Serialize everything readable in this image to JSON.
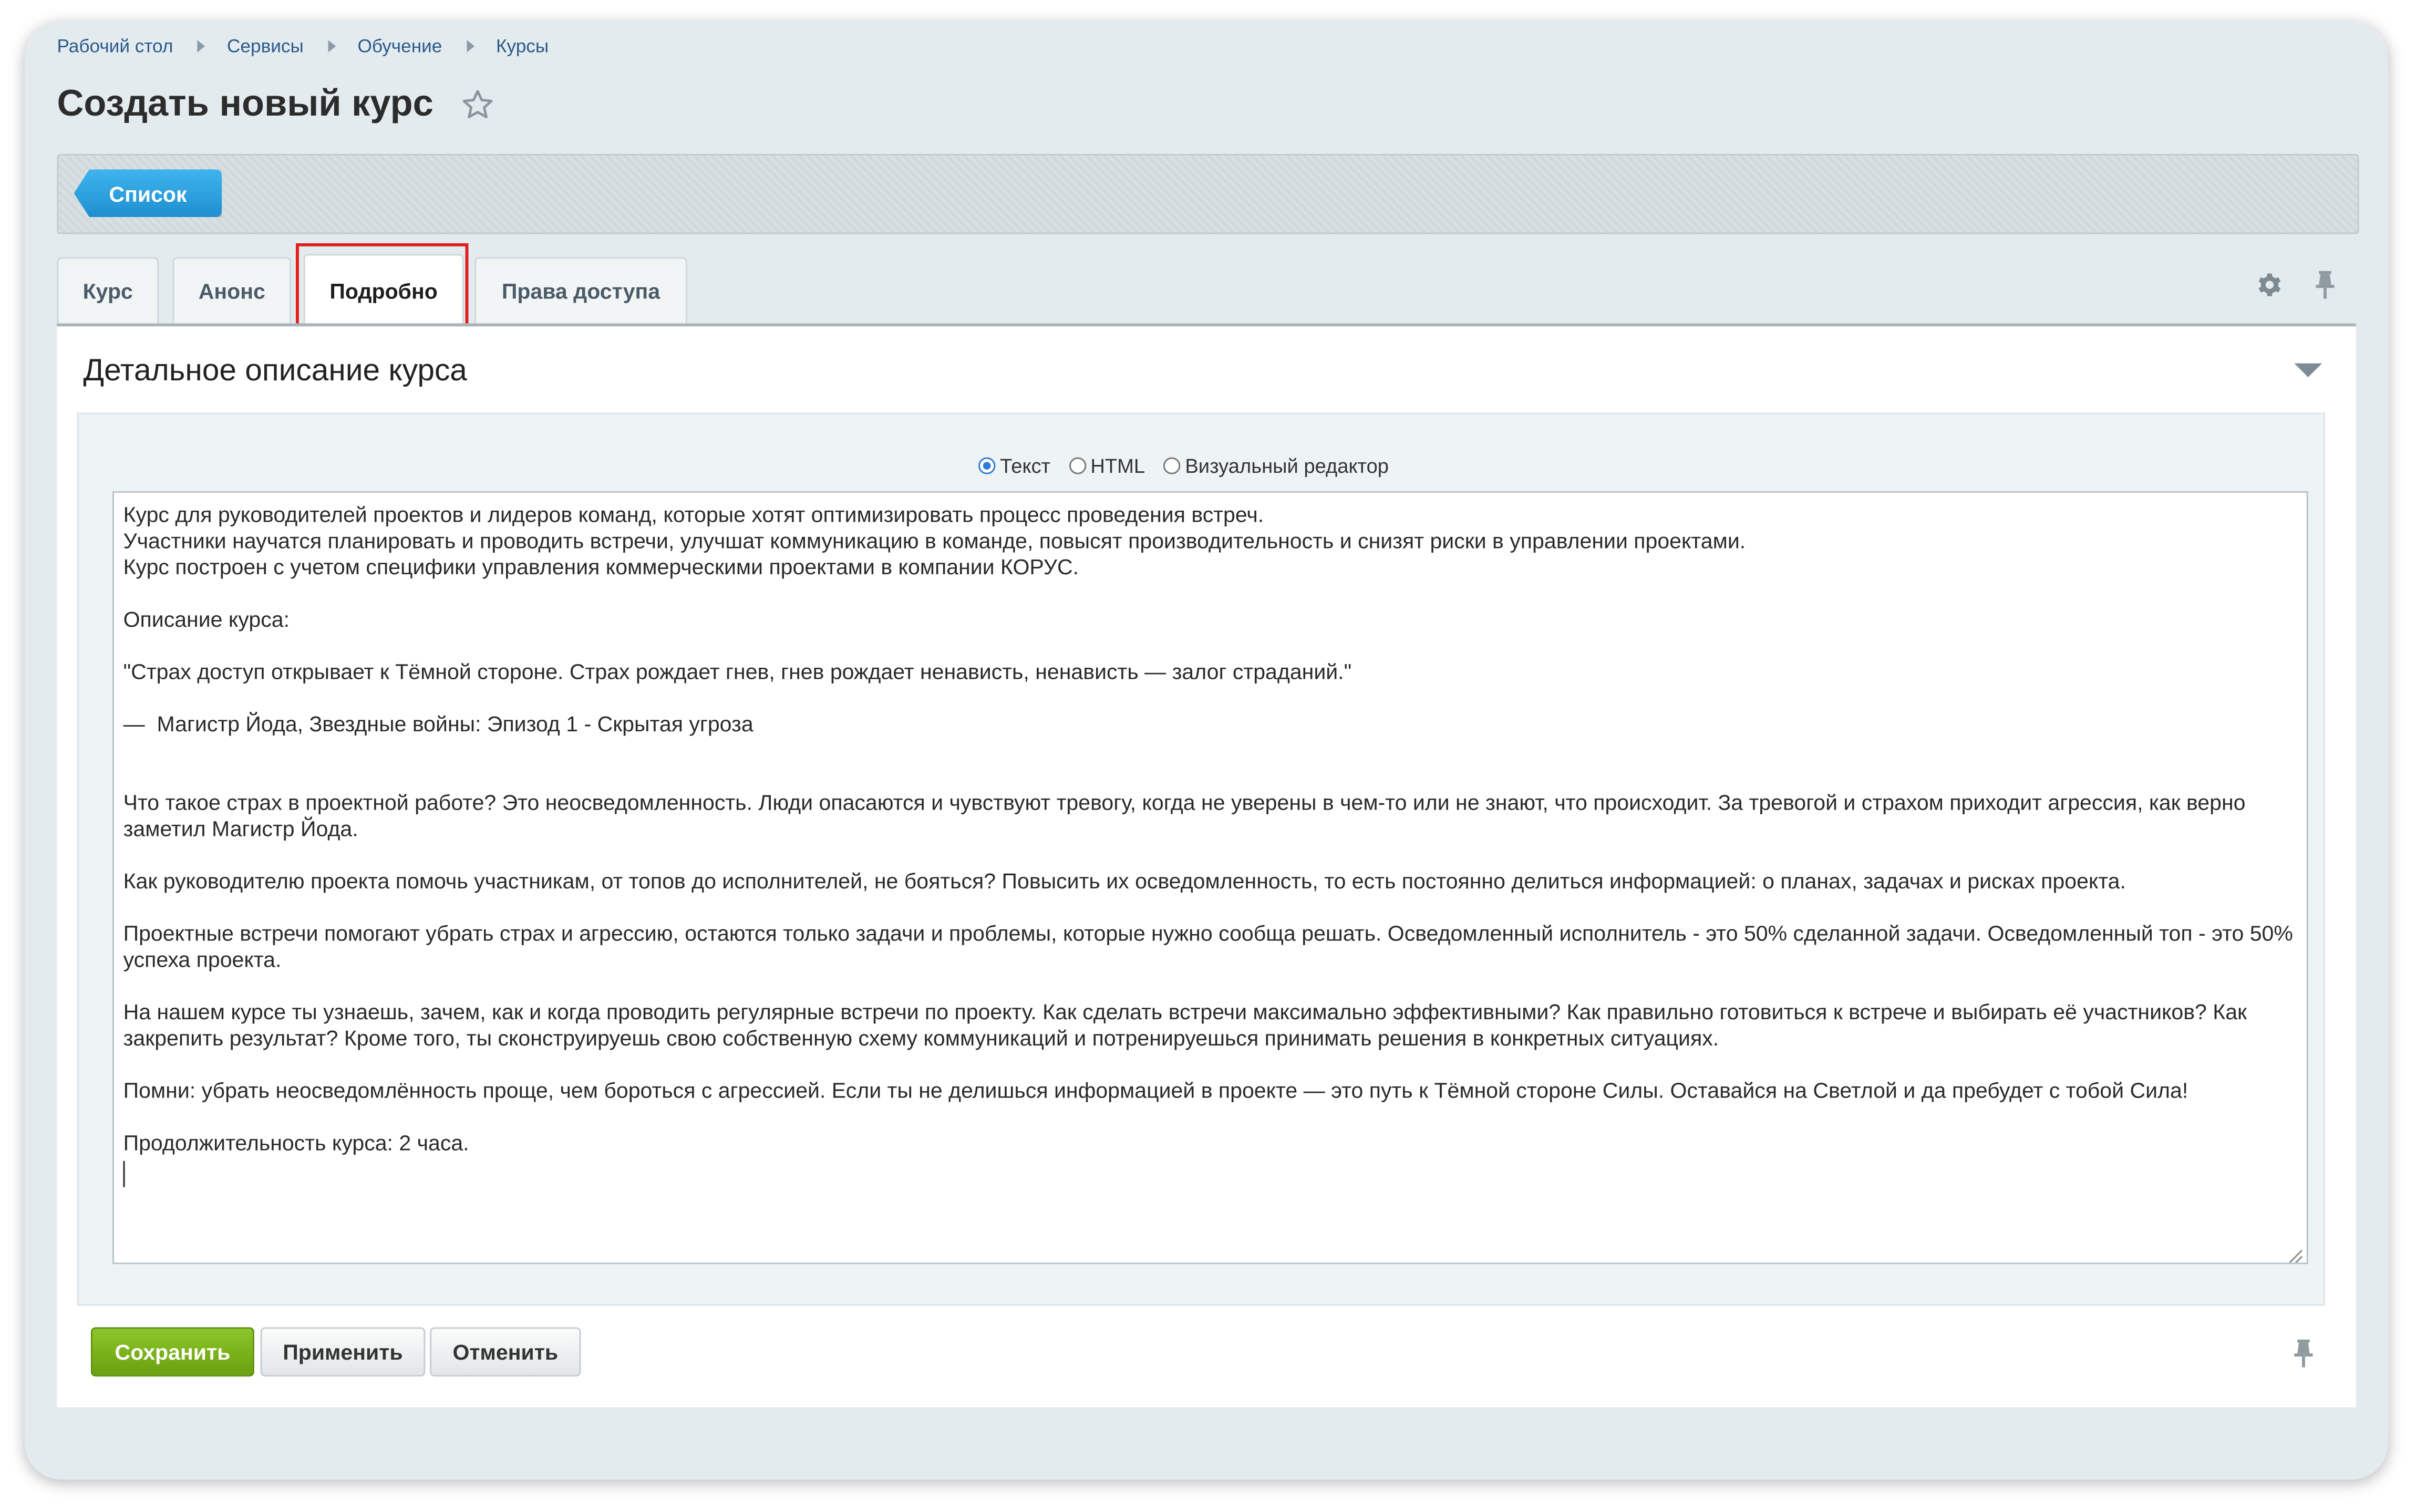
{
  "breadcrumb": [
    {
      "label": "Рабочий стол"
    },
    {
      "label": "Сервисы"
    },
    {
      "label": "Обучение"
    },
    {
      "label": "Курсы"
    }
  ],
  "page": {
    "title": "Создать новый курс"
  },
  "toolbar": {
    "list_label": "Список"
  },
  "tabs": [
    {
      "label": "Курс"
    },
    {
      "label": "Анонс"
    },
    {
      "label": "Подробно",
      "active": true
    },
    {
      "label": "Права доступа"
    }
  ],
  "section": {
    "title": "Детальное описание курса"
  },
  "editor": {
    "modes": [
      {
        "label": "Текст",
        "selected": true
      },
      {
        "label": "HTML",
        "selected": false
      },
      {
        "label": "Визуальный редактор",
        "selected": false
      }
    ],
    "lines": [
      "Курс для руководителей проектов и лидеров команд, которые хотят оптимизировать процесс проведения встреч.",
      "Участники научатся планировать и проводить встречи, улучшат коммуникацию в команде, повысят производительность и снизят риски в управлении проектами.",
      "Курс построен с учетом специфики управления коммерческими проектами в компании КОРУС.",
      "",
      "Описание курса:",
      "",
      "\"Страх доступ открывает к Тёмной стороне. Страх рождает гнев, гнев рождает ненависть, ненависть — залог страданий.\"",
      "",
      "—  Магистр Йода, Звездные войны: Эпизод 1 - Скрытая угроза",
      "",
      "",
      "Что такое страх в проектной работе? Это неосведомленность. Люди опасаются и чувствуют тревогу, когда не уверены в чем-то или не знают, что происходит. За тревогой и страхом приходит агрессия, как верно заметил Магистр Йода.",
      "",
      "Как руководителю проекта помочь участникам, от топов до исполнителей, не бояться? Повысить их осведомленность, то есть постоянно делиться информацией: о планах, задачах и рисках проекта.",
      "",
      "Проектные встречи помогают убрать страх и агрессию, остаются только задачи и проблемы, которые нужно сообща решать. Осведомленный исполнитель - это 50% сделанной задачи. Осведомленный топ - это 50% успеха проекта.",
      "",
      "На нашем курсе ты узнаешь, зачем, как и когда проводить регулярные встречи по проекту. Как сделать встречи максимально эффективными? Как правильно готовиться к встрече и выбирать её участников? Как закрепить результат? Кроме того, ты сконструируешь свою собственную схему коммуникаций и потренируешься принимать решения в конкретных ситуациях.",
      "",
      "Помни: убрать неосведомлённость проще, чем бороться с агрессией. Если ты не делишься информацией в проекте — это путь к Тёмной стороне Силы. Оставайся на Светлой и да пребудет с тобой Сила!",
      "",
      "Продолжительность курса: 2 часа."
    ]
  },
  "actions": {
    "save_label": "Сохранить",
    "apply_label": "Применить",
    "cancel_label": "Отменить"
  },
  "colors": {
    "accent_blue": "#2a9fe0",
    "save_green": "#7bb31c",
    "highlight_red": "#e01e1e"
  },
  "icons": [
    "star-icon",
    "gear-icon",
    "pin-icon",
    "chevron-down-icon",
    "resize-handle-icon"
  ]
}
